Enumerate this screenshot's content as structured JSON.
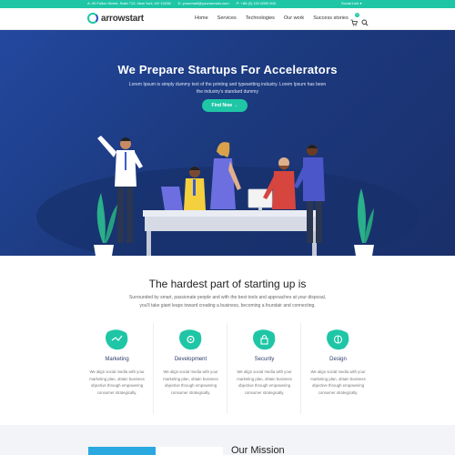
{
  "topbar": {
    "address": "A: 90 Fulton Street, Suite 712, New York, NY 10038",
    "email": "E: youremail@yourdomain.com",
    "phone": "P: +88 (0) 101 0000 000",
    "social": "Social Link ▾"
  },
  "header": {
    "logo": "arrowstart",
    "nav": [
      "Home",
      "Services",
      "Technologies",
      "Our work",
      "Success stories"
    ],
    "cart_count": "0"
  },
  "hero": {
    "title": "We Prepare Startups For Accelerators",
    "subtitle": "Lorem Ipsum is simply dummy text of the printing and typesetting industry. Lorem Ipsum has been the industry's standard dummy",
    "button": "Find Now →"
  },
  "section2": {
    "title": "The hardest part of starting up is",
    "text": "Surrounded by smart, passionate people and with the best tools and approaches at your disposal, you'll take giant leaps toward creating a business, becoming a foundair and connecting."
  },
  "services": [
    {
      "title": "Marketing",
      "text": "We align social media with your marketing plan, obtain business objective through empowering consumer strategically.",
      "icon": "marketing-icon"
    },
    {
      "title": "Development",
      "text": "We align social media with your marketing plan, obtain business objective through empowering consumer strategically.",
      "icon": "development-icon"
    },
    {
      "title": "Security",
      "text": "We align social media with your marketing plan, obtain business objective through empowering consumer strategically.",
      "icon": "security-icon"
    },
    {
      "title": "Design",
      "text": "We align social media with your marketing plan, obtain business objective through empowering consumer strategically.",
      "icon": "design-icon"
    }
  ],
  "mission": {
    "title": "Our Mission"
  },
  "colors": {
    "accent": "#1fc6a6",
    "hero": "#1c3a7f",
    "brand_blue": "#2c4ec2"
  }
}
